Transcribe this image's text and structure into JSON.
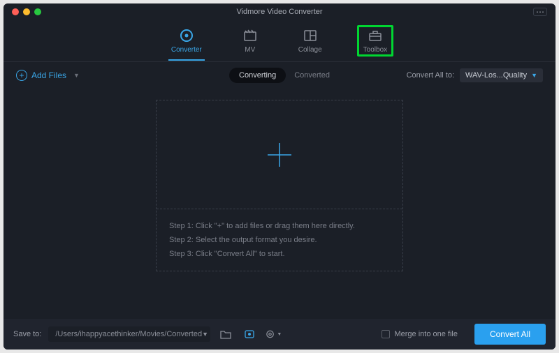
{
  "title": "Vidmore Video Converter",
  "nav": {
    "converter": "Converter",
    "mv": "MV",
    "collage": "Collage",
    "toolbox": "Toolbox"
  },
  "addFiles": "Add Files",
  "tabs": {
    "converting": "Converting",
    "converted": "Converted"
  },
  "convertAllLabel": "Convert All to:",
  "formatSelected": "WAV-Los...Quality",
  "steps": {
    "s1": "Step 1: Click \"+\" to add files or drag them here directly.",
    "s2": "Step 2: Select the output format you desire.",
    "s3": "Step 3: Click \"Convert All\" to start."
  },
  "saveToLabel": "Save to:",
  "savePath": "/Users/ihappyacethinker/Movies/Converted",
  "mergeLabel": "Merge into one file",
  "convertBtn": "Convert All"
}
